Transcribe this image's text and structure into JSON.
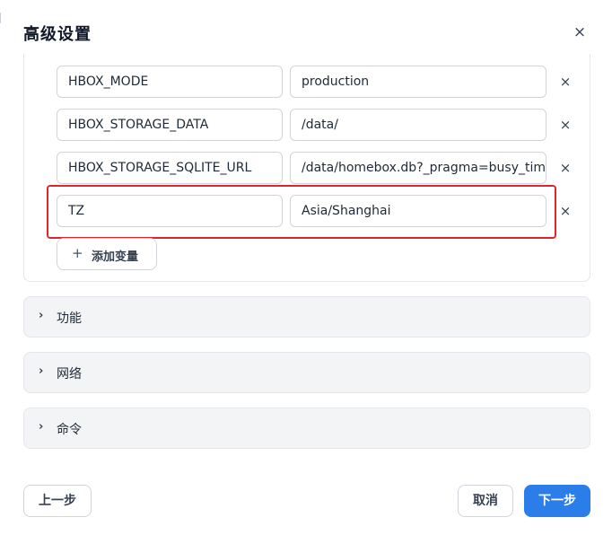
{
  "dialog": {
    "title": "高级设置",
    "close_glyph": "×"
  },
  "env": {
    "rows": [
      {
        "key": "HBOX_MODE",
        "value": "production",
        "remove_glyph": "×"
      },
      {
        "key": "HBOX_STORAGE_DATA",
        "value": "/data/",
        "remove_glyph": "×"
      },
      {
        "key": "HBOX_STORAGE_SQLITE_URL",
        "value": "/data/homebox.db?_pragma=busy_timeou",
        "remove_glyph": "×"
      },
      {
        "key": "TZ",
        "value": "Asia/Shanghai",
        "remove_glyph": "×"
      }
    ],
    "add_glyph": "+",
    "add_label": "添加变量",
    "highlight_color": "#e0262b"
  },
  "sections": [
    {
      "label": "功能",
      "chevron": "›"
    },
    {
      "label": "网络",
      "chevron": "›"
    },
    {
      "label": "命令",
      "chevron": "›"
    }
  ],
  "footer": {
    "prev_label": "上一步",
    "cancel_label": "取消",
    "next_label": "下一步"
  },
  "colors": {
    "primary": "#2b7de9",
    "highlight": "#e0262b",
    "section_bg": "#f3f4f6"
  }
}
